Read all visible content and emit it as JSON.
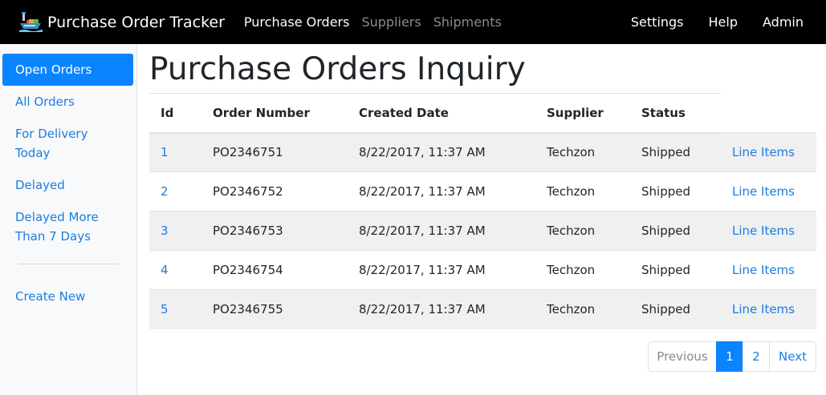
{
  "navbar": {
    "brand": "Purchase Order Tracker",
    "links": [
      "Purchase Orders",
      "Suppliers",
      "Shipments"
    ],
    "right_links": [
      "Settings",
      "Help",
      "Admin"
    ]
  },
  "sidebar": {
    "items": [
      "Open Orders",
      "All Orders",
      "For Delivery Today",
      "Delayed",
      "Delayed More Than 7 Days"
    ],
    "create_new": "Create New"
  },
  "main": {
    "title": "Purchase Orders Inquiry",
    "columns": [
      "Id",
      "Order Number",
      "Created Date",
      "Supplier",
      "Status"
    ],
    "rows": [
      {
        "id": "1",
        "order_number": "PO2346751",
        "created": "8/22/2017, 11:37 AM",
        "supplier": "Techzon",
        "status": "Shipped",
        "action": "Line Items"
      },
      {
        "id": "2",
        "order_number": "PO2346752",
        "created": "8/22/2017, 11:37 AM",
        "supplier": "Techzon",
        "status": "Shipped",
        "action": "Line Items"
      },
      {
        "id": "3",
        "order_number": "PO2346753",
        "created": "8/22/2017, 11:37 AM",
        "supplier": "Techzon",
        "status": "Shipped",
        "action": "Line Items"
      },
      {
        "id": "4",
        "order_number": "PO2346754",
        "created": "8/22/2017, 11:37 AM",
        "supplier": "Techzon",
        "status": "Shipped",
        "action": "Line Items"
      },
      {
        "id": "5",
        "order_number": "PO2346755",
        "created": "8/22/2017, 11:37 AM",
        "supplier": "Techzon",
        "status": "Shipped",
        "action": "Line Items"
      }
    ]
  },
  "pagination": {
    "previous": "Previous",
    "pages": [
      "1",
      "2"
    ],
    "current_page": "1",
    "next": "Next"
  },
  "colors": {
    "navbar_bg": "#000000",
    "accent": "#0a84ff",
    "link": "#1a7de0"
  },
  "icons": {
    "brand_logo": "cargo-ship-icon"
  }
}
